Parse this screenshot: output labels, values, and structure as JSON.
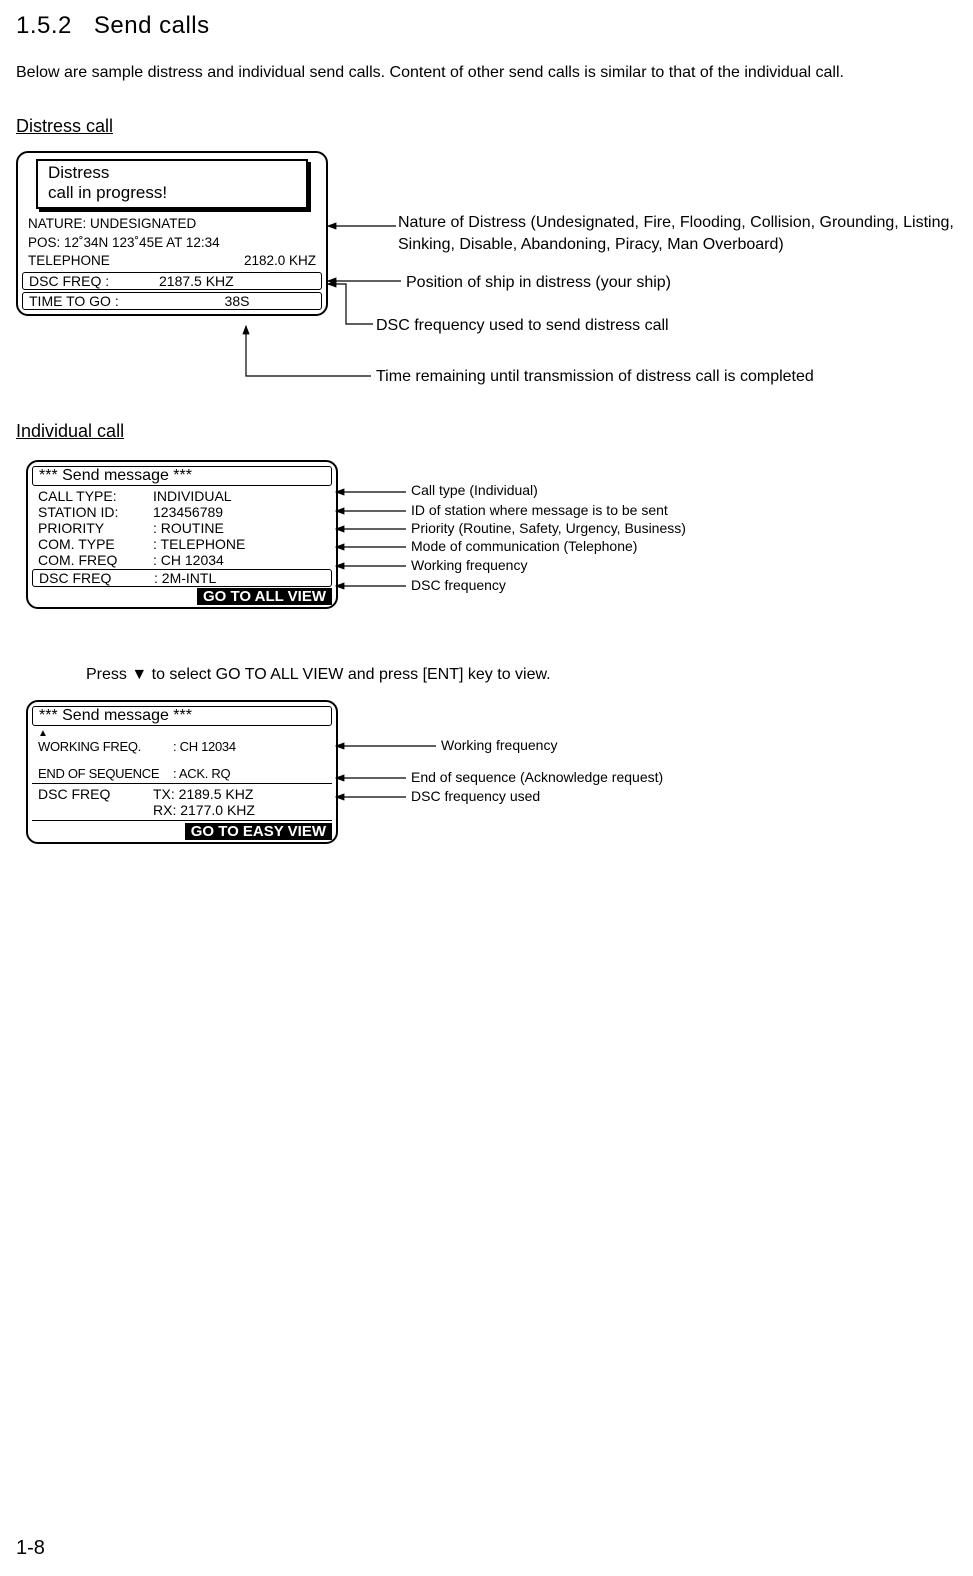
{
  "section": {
    "number": "1.5.2",
    "title": "Send calls"
  },
  "intro": "Below are sample distress and individual send calls. Content of other send calls is similar to that of the individual call.",
  "headings": {
    "distress": "Distress call",
    "individual": "Individual call"
  },
  "distress_screen": {
    "popup_line1": "Distress",
    "popup_line2": "call in progress!",
    "nature": "NATURE: UNDESIGNATED",
    "pos": "POS: 12˚34N 123˚45E AT 12:34",
    "tel_label": "TELEPHONE",
    "tel_value": "2182.0 KHZ",
    "dsc_label": "DSC FREQ    :",
    "dsc_value": "2187.5 KHZ",
    "ttg_label": "TIME TO GO :",
    "ttg_value": "38S"
  },
  "distress_callouts": {
    "nature": "Nature of Distress (Undesignated, Fire, Flooding, Collision, Grounding, Listing, Sinking, Disable, Abandoning, Piracy, Man Overboard)",
    "position": "Position of ship in distress (your ship)",
    "dsc": "DSC frequency used to send distress call",
    "ttg": "Time remaining until transmission of distress call is completed"
  },
  "individual_screen1": {
    "title": "*** Send message ***",
    "rows": [
      {
        "k": "CALL TYPE:",
        "v": "INDIVIDUAL"
      },
      {
        "k": "STATION ID:",
        "v": "123456789"
      },
      {
        "k": "PRIORITY",
        "v": ": ROUTINE"
      },
      {
        "k": "COM. TYPE",
        "v": ": TELEPHONE"
      },
      {
        "k": "COM. FREQ",
        "v": ": CH 12034"
      }
    ],
    "dsc": {
      "k": "DSC FREQ",
      "v": ": 2M-INTL"
    },
    "goto": "GO TO ALL VIEW"
  },
  "individual_callouts1": [
    "Call type (Individual)",
    "ID of station where message is to be sent",
    "Priority (Routine, Safety, Urgency, Business)",
    "Mode of communication (Telephone)",
    "Working frequency",
    "DSC frequency"
  ],
  "instruction": "Press ▼ to select GO TO ALL VIEW and press [ENT] key to view.",
  "individual_screen2": {
    "title": "*** Send message ***",
    "up_arrow": "▲",
    "wf": {
      "k": "WORKING FREQ.",
      "v": ": CH 12034"
    },
    "eos": {
      "k": "END OF SEQUENCE",
      "v": ": ACK. RQ"
    },
    "dsc_label": "DSC FREQ",
    "dsc_tx": "TX: 2189.5 KHZ",
    "dsc_rx": "RX: 2177.0 KHZ",
    "goto": "GO TO EASY VIEW"
  },
  "individual_callouts2": {
    "wf": "Working frequency",
    "eos": "End of sequence (Acknowledge request)",
    "dsc": "DSC frequency used"
  },
  "page": "1-8"
}
